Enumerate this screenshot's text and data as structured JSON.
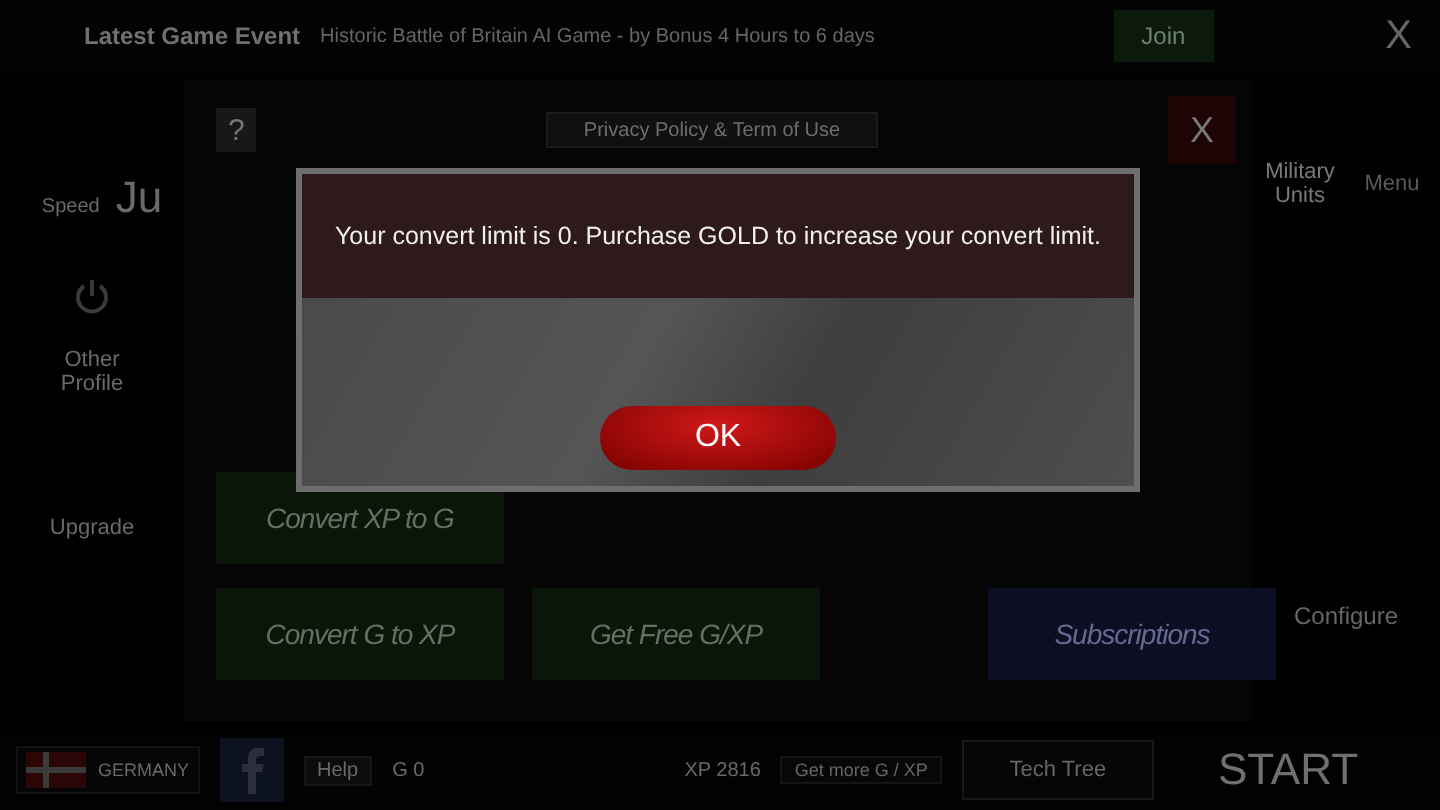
{
  "top_bar": {
    "event_title": "Latest Game Event",
    "event_text": "Historic Battle of Britain AI Game - by  Bonus 4 Hours to 6 days",
    "join_button": "Join",
    "close_button": "X"
  },
  "sidebar": {
    "speed_label": "Speed",
    "player_name": "Ju",
    "profile_label": "Other Profile",
    "upgrade_label": "Upgrade"
  },
  "panel": {
    "help_button": "?",
    "privacy_button": "Privacy Policy & Term of Use",
    "close_button": "X",
    "actions": [
      {
        "label": "Convert XP to G",
        "kind": "green"
      },
      {
        "label": "Convert G to XP",
        "kind": "green"
      },
      {
        "label": "Get Free G/XP",
        "kind": "green"
      },
      {
        "label": "Subscriptions",
        "kind": "blue"
      }
    ]
  },
  "right_column": {
    "tabs": [
      {
        "label": "Military Units",
        "selected": true
      },
      {
        "label": "Menu",
        "selected": false
      }
    ],
    "configure_button": "Configure"
  },
  "bottom_bar": {
    "country": "GERMANY",
    "help_button": "Help",
    "gold": "G 0",
    "xp": "XP 2816",
    "get_more_button": "Get more G / XP",
    "tech_tree_button": "Tech Tree",
    "start_button": "START"
  },
  "dialog": {
    "message": "Your convert limit is 0. Purchase GOLD to increase your convert limit.",
    "ok_button": "OK"
  }
}
